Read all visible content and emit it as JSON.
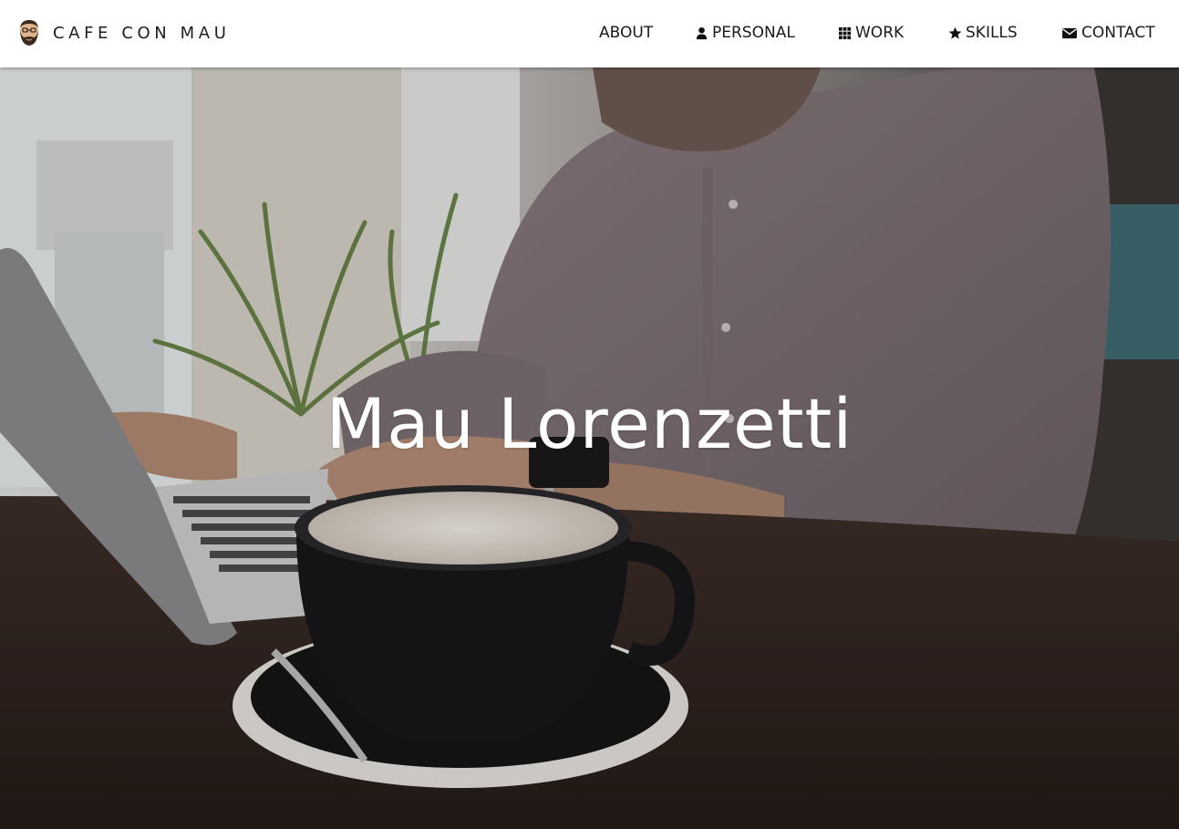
{
  "brand": {
    "name": "CAFE CON MAU",
    "avatar_icon": "bearded-man-avatar-icon"
  },
  "nav": {
    "about": {
      "label": "ABOUT"
    },
    "personal": {
      "label": "PERSONAL",
      "icon": "user-icon"
    },
    "work": {
      "label": "WORK",
      "icon": "grid-icon"
    },
    "skills": {
      "label": "SKILLS",
      "icon": "star-icon"
    },
    "contact": {
      "label": "CONTACT",
      "icon": "envelope-icon"
    }
  },
  "hero": {
    "title": "Mau Lorenzetti"
  },
  "colors": {
    "navbar_bg": "#ffffff",
    "nav_text": "#1a1a1a",
    "hero_title": "#ffffff"
  }
}
